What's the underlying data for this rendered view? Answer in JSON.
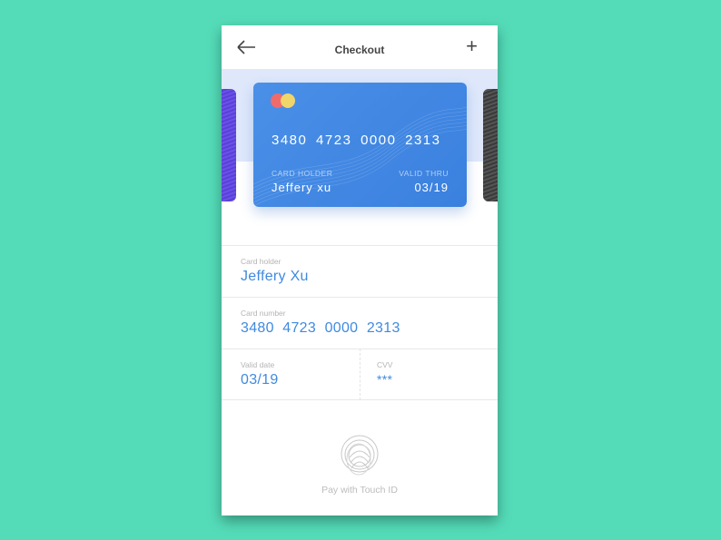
{
  "header": {
    "title": "Checkout",
    "back_icon": "arrow-left-icon",
    "add_icon": "plus-icon"
  },
  "card": {
    "number": "3480 4723 0000 2313",
    "holder_label": "CARD HOLDER",
    "holder": "Jeffery xu",
    "valid_label": "VALID THRU",
    "valid": "03/19",
    "colors": {
      "primary": "#4a90e8",
      "left_card": "#5a3fd8",
      "right_card": "#3a3a3a",
      "mc_red": "#ef6b6b",
      "mc_yellow": "#f0d56a"
    }
  },
  "form": {
    "holder_label": "Card holder",
    "holder": "Jeffery Xu",
    "number_label": "Card number",
    "number": "3480  4723  0000  2313",
    "date_label": "Valid date",
    "date": "03/19",
    "cvv_label": "CVV",
    "cvv": "***"
  },
  "touch": {
    "label": "Pay with Touch ID",
    "icon": "fingerprint-icon"
  }
}
